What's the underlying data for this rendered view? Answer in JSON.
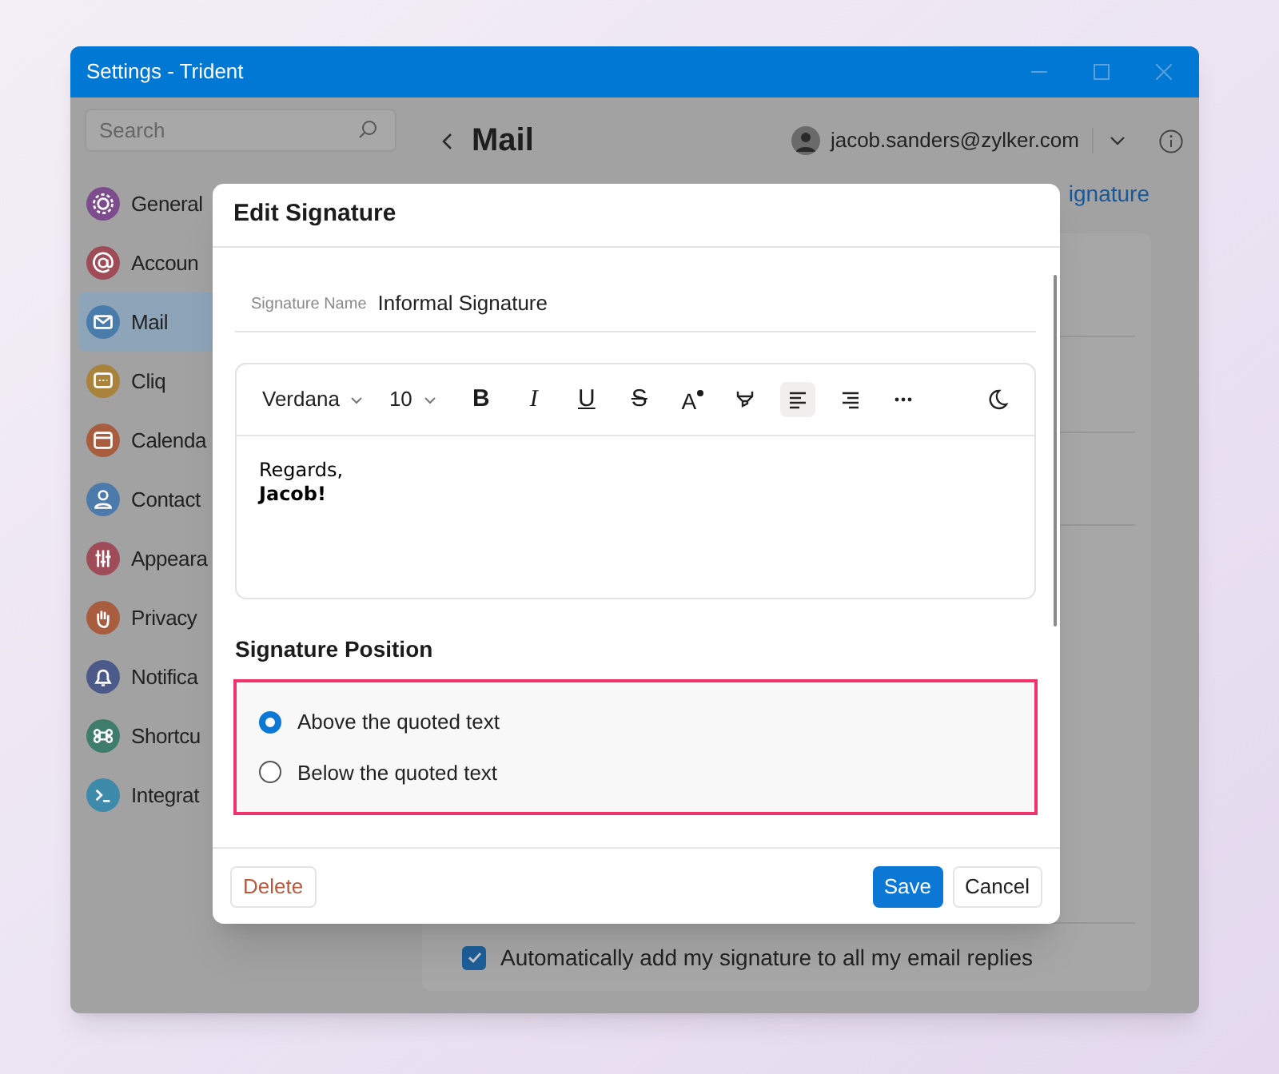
{
  "window": {
    "title": "Settings - Trident"
  },
  "sidebar": {
    "search": {
      "placeholder": "Search"
    },
    "items": [
      {
        "label": "General",
        "color": "#7d4c8c",
        "selected": false
      },
      {
        "label": "Accoun",
        "color": "#a04c58",
        "selected": false
      },
      {
        "label": "Mail",
        "color": "#4a7cab",
        "selected": true
      },
      {
        "label": "Cliq",
        "color": "#a9823c",
        "selected": false
      },
      {
        "label": "Calenda",
        "color": "#a85d3e",
        "selected": false
      },
      {
        "label": "Contact",
        "color": "#4c7bab",
        "selected": false
      },
      {
        "label": "Appeara",
        "color": "#a04c58",
        "selected": false
      },
      {
        "label": "Privacy",
        "color": "#a85d3e",
        "selected": false
      },
      {
        "label": "Notifica",
        "color": "#4c5a8a",
        "selected": false
      },
      {
        "label": "Shortcu",
        "color": "#3e7c6c",
        "selected": false
      },
      {
        "label": "Integrat",
        "color": "#3d8aab",
        "selected": false
      }
    ]
  },
  "header": {
    "title": "Mail",
    "account": "jacob.sanders@zylker.com",
    "link": "ignature"
  },
  "auto_reply_option": {
    "label": "Automatically add my signature to all my email replies",
    "checked": true
  },
  "dialog": {
    "title": "Edit Signature",
    "name_label": "Signature Name",
    "name_value": "Informal Signature",
    "toolbar": {
      "font": "Verdana",
      "size": "10",
      "buttons": [
        {
          "kind": "bold",
          "label": "B",
          "selected": false
        },
        {
          "kind": "italic",
          "label": "I",
          "selected": false
        },
        {
          "kind": "underline",
          "label": "U",
          "selected": false
        },
        {
          "kind": "strike",
          "label": "S",
          "selected": false
        },
        {
          "kind": "font_color",
          "label": "A",
          "selected": false
        },
        {
          "kind": "highlight",
          "selected": false
        },
        {
          "kind": "align_left",
          "selected": true
        },
        {
          "kind": "align_right",
          "selected": false
        },
        {
          "kind": "more",
          "selected": false
        },
        {
          "kind": "dark_mode",
          "selected": false
        }
      ]
    },
    "body": [
      {
        "text": "Regards,",
        "bold": false
      },
      {
        "text": "Jacob!",
        "bold": true
      }
    ],
    "position": {
      "title": "Signature Position",
      "options": [
        {
          "label": "Above the quoted text",
          "selected": true
        },
        {
          "label": "Below the quoted text",
          "selected": false
        }
      ]
    },
    "buttons": [
      {
        "kind": "delete",
        "label": "Delete"
      },
      {
        "kind": "primary",
        "label": "Save"
      },
      {
        "kind": "secondary",
        "label": "Cancel"
      }
    ]
  }
}
